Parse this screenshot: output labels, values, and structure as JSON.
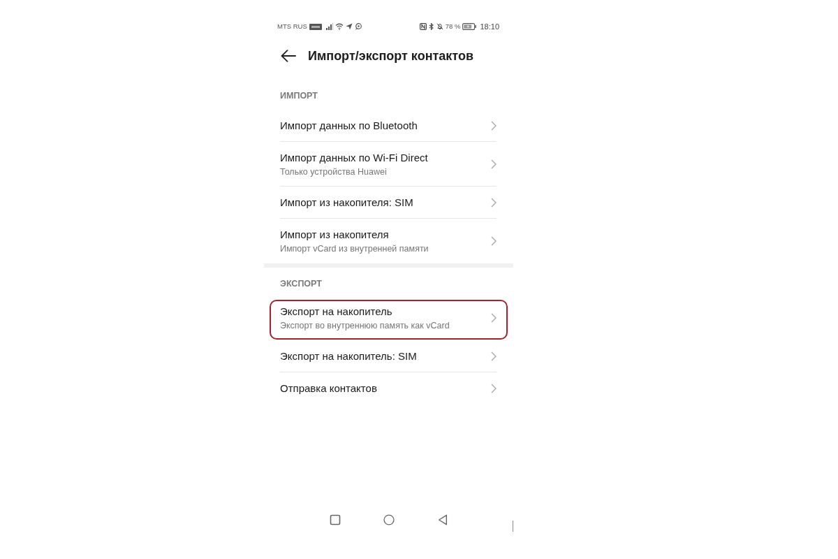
{
  "status_bar": {
    "carrier": "MTS RUS",
    "battery": "78 %",
    "time": "18:10"
  },
  "header": {
    "title": "Импорт/экспорт контактов"
  },
  "sections": [
    {
      "title": "ИМПОРТ",
      "items": [
        {
          "title": "Импорт данных по Bluetooth",
          "highlighted": false
        },
        {
          "title": "Импорт данных по Wi-Fi Direct",
          "subtitle": "Только устройства Huawei",
          "highlighted": false
        },
        {
          "title": "Импорт из накопителя: SIM",
          "highlighted": false
        },
        {
          "title": "Импорт из накопителя",
          "subtitle": "Импорт vCard из внутренней памяти",
          "highlighted": false
        }
      ]
    },
    {
      "title": "ЭКСПОРТ",
      "items": [
        {
          "title": "Экспорт на накопитель",
          "subtitle": "Экспорт во внутреннюю память как vCard",
          "highlighted": true
        },
        {
          "title": "Экспорт на накопитель: SIM",
          "highlighted": false
        },
        {
          "title": "Отправка контактов",
          "highlighted": false
        }
      ]
    }
  ]
}
